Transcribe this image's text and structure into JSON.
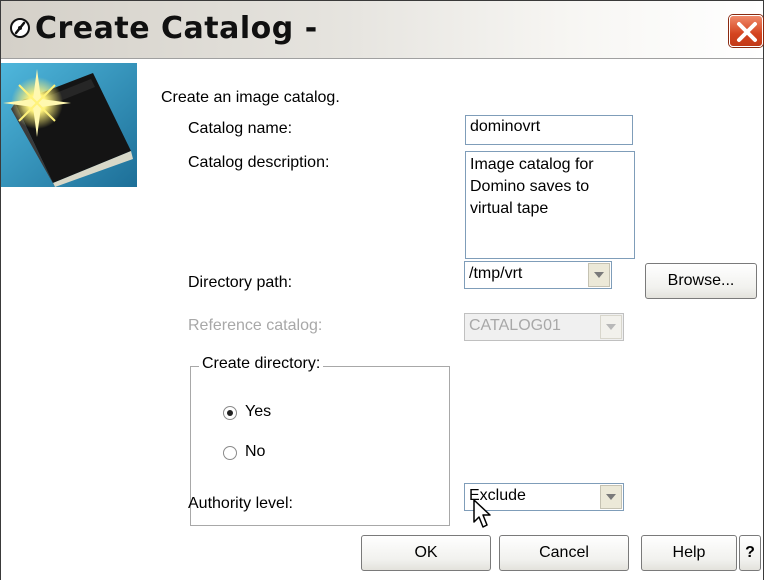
{
  "window": {
    "title": "Create Catalog -",
    "title_icon": "ibm-navigator-icon",
    "close_icon": "close-icon",
    "accent_close": "#d4431f"
  },
  "form": {
    "intro": "Create an image catalog.",
    "catalog_name_label": "Catalog name:",
    "catalog_name_value": "dominovrt",
    "catalog_description_label": "Catalog description:",
    "catalog_description_value": "Image catalog for\nDomino saves to\nvirtual tape",
    "directory_path_label": "Directory path:",
    "directory_path_value": "/tmp/vrt",
    "browse_label": "Browse...",
    "reference_catalog_label": "Reference catalog:",
    "reference_catalog_value": "CATALOG01",
    "create_directory_label": "Create directory:",
    "create_directory_options": [
      {
        "label": "Yes",
        "selected": true
      },
      {
        "label": "No",
        "selected": false
      }
    ],
    "authority_level_label": "Authority level:",
    "authority_level_value": "Exclude"
  },
  "buttons": {
    "ok": "OK",
    "cancel": "Cancel",
    "help": "Help",
    "whats_this": "?"
  }
}
